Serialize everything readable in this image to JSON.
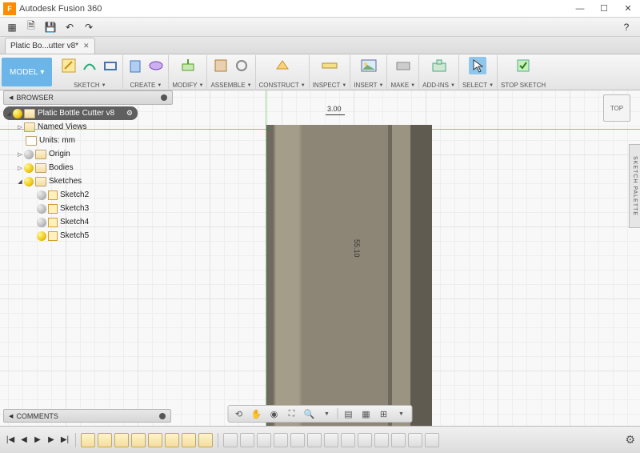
{
  "app": {
    "title": "Autodesk Fusion 360",
    "icon_letter": "F"
  },
  "tab": {
    "label": "Platic Bo...utter v8*"
  },
  "ribbon": {
    "model": "MODEL",
    "groups": {
      "sketch": "SKETCH",
      "create": "CREATE",
      "modify": "MODIFY",
      "assemble": "ASSEMBLE",
      "construct": "CONSTRUCT",
      "inspect": "INSPECT",
      "insert": "INSERT",
      "make": "MAKE",
      "addins": "ADD-INS",
      "select": "SELECT",
      "stop": "STOP SKETCH"
    }
  },
  "viewcube": "TOP",
  "palette": "SKETCH PALETTE",
  "browser": {
    "title": "BROWSER",
    "root": "Platic Bottle Cutter v8",
    "items": {
      "named": "Named Views",
      "units": "Units: mm",
      "origin": "Origin",
      "bodies": "Bodies",
      "sketches": "Sketches",
      "sk2": "Sketch2",
      "sk3": "Sketch3",
      "sk4": "Sketch4",
      "sk5": "Sketch5"
    }
  },
  "dims": {
    "top": "3.00",
    "side": "55.10"
  },
  "comments": "COMMENTS"
}
